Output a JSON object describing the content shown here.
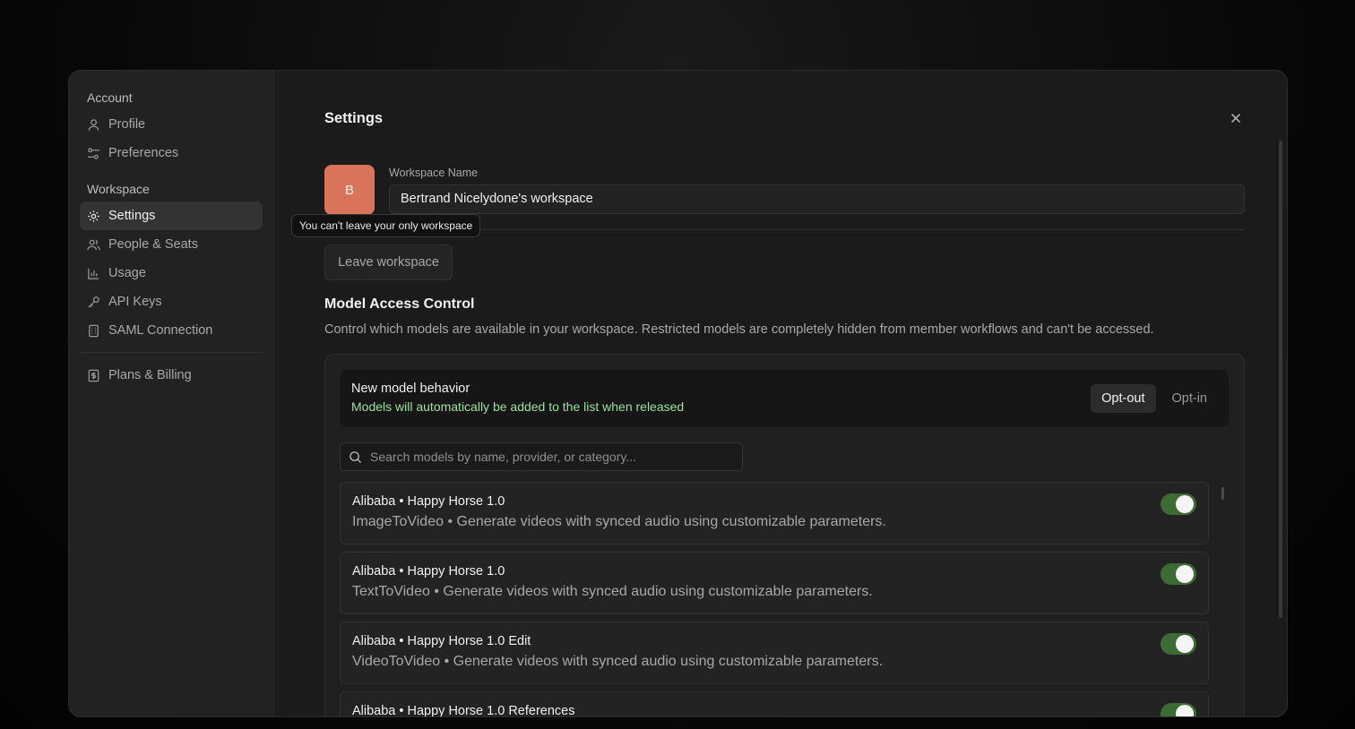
{
  "sidebar": {
    "account_heading": "Account",
    "account_items": [
      {
        "label": "Profile",
        "icon": "user-icon"
      },
      {
        "label": "Preferences",
        "icon": "sliders-icon"
      }
    ],
    "workspace_heading": "Workspace",
    "workspace_items": [
      {
        "label": "Settings",
        "icon": "gear-icon",
        "active": true
      },
      {
        "label": "People & Seats",
        "icon": "users-icon"
      },
      {
        "label": "Usage",
        "icon": "bar-chart-icon"
      },
      {
        "label": "API Keys",
        "icon": "key-icon"
      },
      {
        "label": "SAML Connection",
        "icon": "building-icon"
      }
    ],
    "billing_item": {
      "label": "Plans & Billing",
      "icon": "receipt-icon"
    }
  },
  "main": {
    "title": "Settings",
    "avatar_letter": "B",
    "workspace_name_label": "Workspace Name",
    "workspace_name_value": "Bertrand Nicelydone's workspace",
    "tooltip": "You can't leave your only workspace",
    "leave_button": "Leave workspace",
    "mac_title": "Model Access Control",
    "mac_description": "Control which models are available in your workspace. Restricted models are completely hidden from member workflows and can't be accessed.",
    "behavior": {
      "title": "New model behavior",
      "subtitle": "Models will automatically be added to the list when released",
      "options": [
        "Opt-out",
        "Opt-in"
      ],
      "selected": "Opt-out"
    },
    "search_placeholder": "Search models by name, provider, or category...",
    "models": [
      {
        "name": "Alibaba • Happy Horse 1.0",
        "description": "ImageToVideo • Generate videos with synced audio using customizable parameters.",
        "enabled": true
      },
      {
        "name": "Alibaba • Happy Horse 1.0",
        "description": "TextToVideo • Generate videos with synced audio using customizable parameters.",
        "enabled": true
      },
      {
        "name": "Alibaba • Happy Horse 1.0 Edit",
        "description": "VideoToVideo • Generate videos with synced audio using customizable parameters.",
        "enabled": true
      },
      {
        "name": "Alibaba • Happy Horse 1.0 References",
        "description": "",
        "enabled": true
      }
    ]
  },
  "colors": {
    "accent_avatar": "#d9745a",
    "toggle_on": "#3d6b34",
    "behavior_subtitle": "#9be29b"
  }
}
